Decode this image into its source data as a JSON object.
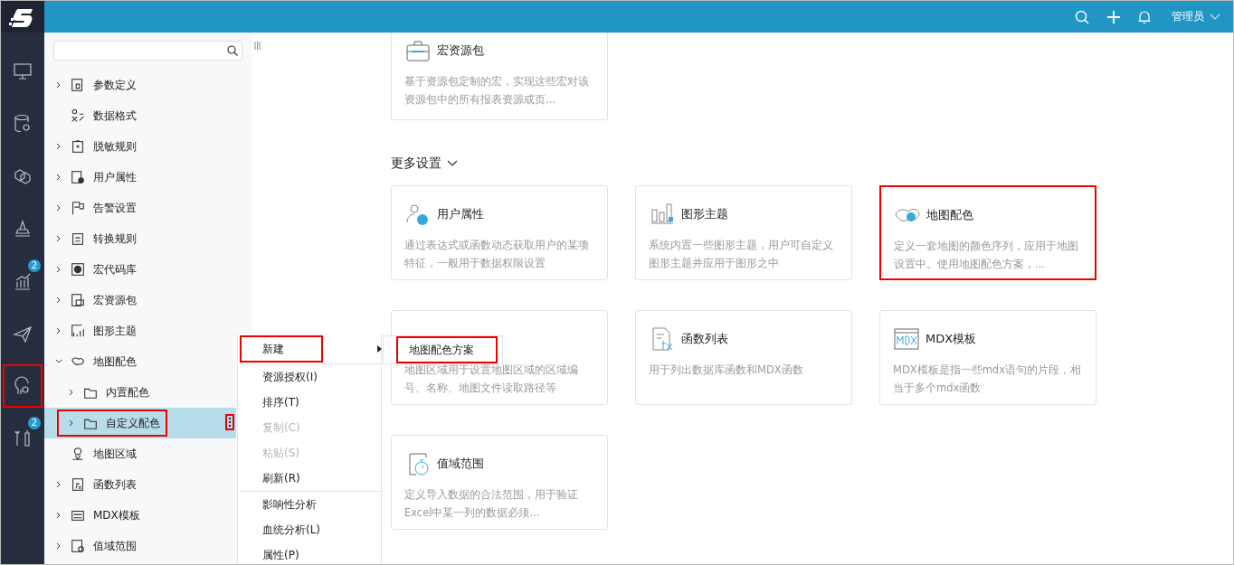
{
  "header": {
    "user": "管理员"
  },
  "rail": [
    {
      "highlighted": false
    },
    {
      "highlighted": false
    },
    {
      "highlighted": false
    },
    {
      "highlighted": false
    },
    {
      "badge": "2",
      "highlighted": false
    },
    {
      "highlighted": false
    },
    {
      "highlighted": true
    },
    {
      "badge": "2",
      "highlighted": false
    }
  ],
  "tree": [
    {
      "label": "参数定义",
      "expanded": false
    },
    {
      "label": "数据格式"
    },
    {
      "label": "脱敏规则",
      "expanded": false
    },
    {
      "label": "用户属性",
      "expanded": false
    },
    {
      "label": "告警设置",
      "expanded": false
    },
    {
      "label": "转换规则",
      "expanded": false
    },
    {
      "label": "宏代码库",
      "expanded": false
    },
    {
      "label": "宏资源包",
      "expanded": false
    },
    {
      "label": "图形主题",
      "expanded": false
    },
    {
      "label": "地图配色",
      "expanded": true,
      "children": [
        {
          "label": "内置配色",
          "expanded": false,
          "selected": false,
          "highlighted": false
        },
        {
          "label": "自定义配色",
          "expanded": false,
          "selected": true,
          "highlighted": true
        }
      ]
    },
    {
      "label": "地图区域"
    },
    {
      "label": "函数列表",
      "expanded": false
    },
    {
      "label": "MDX模板",
      "expanded": false
    },
    {
      "label": "值域范围",
      "expanded": false
    }
  ],
  "top_card": {
    "title": "宏资源包",
    "description": "基于资源包定制的宏，实现这些宏对该资源包中的所有报表资源或页..."
  },
  "section": {
    "title": "更多设置"
  },
  "cards": [
    {
      "title": "用户属性",
      "description": "通过表达式或函数动态获取用户的某项特征，一般用于数据权限设置",
      "highlighted": false
    },
    {
      "title": "图形主题",
      "description": "系统内置一些图形主题，用户可自定义图形主题并应用于图形之中",
      "highlighted": false
    },
    {
      "title": "地图配色",
      "description": "定义一套地图的颜色序列，应用于地图设置中。使用地图配色方案，...",
      "highlighted": true
    },
    {
      "description": "地图区域用于设置地图区域的区域编号、名称、地图文件读取路径等",
      "highlighted": false
    },
    {
      "title": "函数列表",
      "description": "用于列出数据库函数和MDX函数",
      "highlighted": false
    },
    {
      "title": "MDX模板",
      "description": "MDX模板是指一些mdx语句的片段，相当于多个mdx函数",
      "highlighted": false
    },
    {
      "title": "值域范围",
      "description": "定义导入数据的合法范围，用于验证Excel中某一列的数据必须...",
      "highlighted": false
    }
  ],
  "context_menu": {
    "groups": [
      [
        {
          "label": "新建",
          "disabled": false,
          "highlighted": true,
          "submenu": true
        }
      ],
      [
        {
          "label": "资源授权(I)",
          "disabled": false,
          "highlighted": false,
          "submenu": false
        },
        {
          "label": "排序(T)",
          "disabled": false,
          "highlighted": false,
          "submenu": false
        },
        {
          "label": "复制(C)",
          "disabled": true,
          "highlighted": false,
          "submenu": false
        },
        {
          "label": "粘贴(S)",
          "disabled": true,
          "highlighted": false,
          "submenu": false
        },
        {
          "label": "刷新(R)",
          "disabled": false,
          "highlighted": false,
          "submenu": false
        }
      ],
      [
        {
          "label": "影响性分析",
          "disabled": false,
          "highlighted": false,
          "submenu": false
        },
        {
          "label": "血统分析(L)",
          "disabled": false,
          "highlighted": false,
          "submenu": false
        },
        {
          "label": "属性(P)",
          "disabled": false,
          "highlighted": false,
          "submenu": false
        }
      ]
    ]
  },
  "submenu": [
    {
      "label": "地图配色方案",
      "highlighted": true
    }
  ]
}
